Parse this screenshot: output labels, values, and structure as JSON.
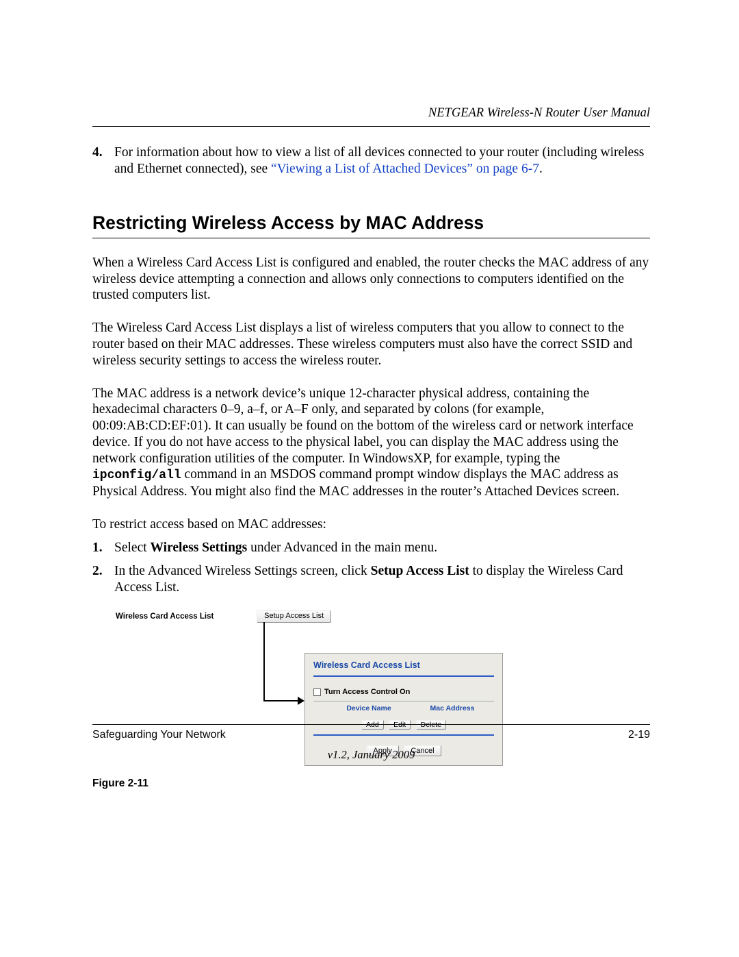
{
  "header": {
    "running": "NETGEAR Wireless-N Router User Manual"
  },
  "step4": {
    "num": "4.",
    "text_before_link": "For information about how to view a list of all devices connected to your router (including wireless and Ethernet connected), see ",
    "link": "“Viewing a List of Attached Devices” on page 6-7",
    "trailing": "."
  },
  "section": {
    "heading": "Restricting Wireless Access by MAC Address"
  },
  "para1": "When a Wireless Card Access List is configured and enabled, the router checks the MAC address of any wireless device attempting a connection and allows only connections to computers identified on the trusted computers list.",
  "para2": "The Wireless Card Access List displays a list of wireless computers that you allow to connect to the router based on their MAC addresses. These wireless computers must also have the correct SSID and wireless security settings to access the wireless router.",
  "para3": {
    "a": "The MAC address is a network device’s unique 12-character physical address, containing the hexadecimal characters 0–9, a–f, or A–F only, and separated by colons (for example, 00:09:AB:CD:EF:01). It can usually be found on the bottom of the wireless card or network interface device. If you do not have access to the physical label, you can display the MAC address using the network configuration utilities of the computer. In WindowsXP, for example, typing the ",
    "cmd": "ipconfig/all",
    "b": " command in an MSDOS command prompt window displays the MAC address as Physical Address. You might also find the MAC addresses in the router’s Attached Devices screen."
  },
  "para4": "To restrict access based on MAC addresses:",
  "step1": {
    "num": "1.",
    "pre": "Select ",
    "bold": "Wireless Settings",
    "post": " under Advanced in the main menu."
  },
  "step2": {
    "num": "2.",
    "pre": "In the Advanced Wireless Settings screen, click ",
    "bold": "Setup Access List",
    "post": " to display the Wireless Card Access List."
  },
  "figure": {
    "row_label": "Wireless Card Access List",
    "row_button": "Setup Access List",
    "dialog": {
      "title": "Wireless Card Access List",
      "checkbox_label": "Turn Access Control On",
      "col_device": "Device Name",
      "col_mac": "Mac Address",
      "btn_add": "Add",
      "btn_edit": "Edit",
      "btn_delete": "Delete",
      "btn_apply": "Apply",
      "btn_cancel": "Cancel"
    },
    "caption": "Figure 2-11"
  },
  "footer": {
    "left": "Safeguarding Your Network",
    "right": "2-19",
    "version": "v1.2, January 2009"
  }
}
